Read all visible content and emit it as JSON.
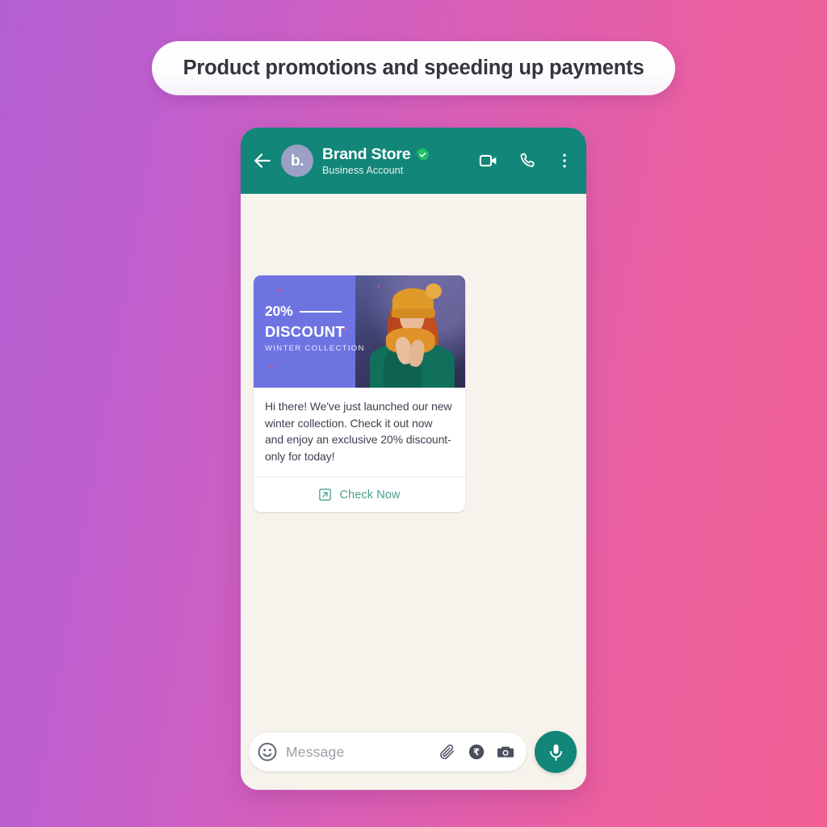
{
  "page": {
    "title": "Product promotions and speeding up payments",
    "background": {
      "from": "#b35fd2",
      "to": "#ef5f94"
    }
  },
  "phone": {
    "header": {
      "back_icon": "back-arrow-icon",
      "avatar_initials": "b.",
      "contact_name": "Brand Store",
      "verified_icon": "verified-badge-icon",
      "subtitle": "Business Account",
      "actions": [
        {
          "name": "video-call-icon",
          "label": "Video call"
        },
        {
          "name": "voice-call-icon",
          "label": "Voice call"
        },
        {
          "name": "more-options-icon",
          "label": "More options"
        }
      ],
      "accent": "#128678"
    },
    "chat": {
      "background": "#f6f3ed",
      "message_card": {
        "promo": {
          "percent": "20%",
          "headline": "DISCOUNT",
          "subhead": "WINTER COLLECTION",
          "panel_color": "#6d74e2"
        },
        "body": "Hi there! We've just launched our new winter collection. Check it out now and enjoy an exclusive 20% discount- only for today!",
        "cta": {
          "label": "Check Now",
          "icon": "external-link-icon",
          "color": "#4f9f90"
        }
      }
    },
    "input_bar": {
      "emoji_icon": "emoji-smiley-icon",
      "placeholder": "Message",
      "value": "",
      "icons": [
        {
          "name": "attachment-paperclip-icon",
          "label": "Attach"
        },
        {
          "name": "rupee-payment-icon",
          "label": "Payment",
          "glyph": "₹"
        },
        {
          "name": "camera-icon",
          "label": "Camera"
        }
      ],
      "mic_icon": "microphone-icon",
      "mic_color": "#128678"
    }
  }
}
